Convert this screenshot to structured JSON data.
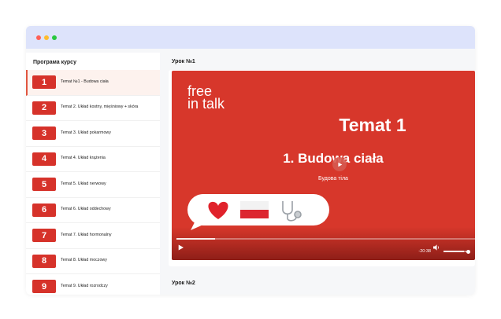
{
  "window": {
    "dots": [
      "#ff5f57",
      "#febc2e",
      "#28c840"
    ]
  },
  "sidebar": {
    "title": "Програма курсу",
    "items": [
      {
        "num": "1",
        "label": "Temat №1 - Budowa ciała"
      },
      {
        "num": "2",
        "label": "Temat 2. Układ kostny, mięśniowy + skóra"
      },
      {
        "num": "3",
        "label": "Temat 3. Układ pokarmowy"
      },
      {
        "num": "4",
        "label": "Temat 4. Układ krążenia"
      },
      {
        "num": "5",
        "label": "Temat 5. Układ nerwowy"
      },
      {
        "num": "6",
        "label": "Temat 6. Układ oddechowy"
      },
      {
        "num": "7",
        "label": "Temat 7. Układ hormonalny"
      },
      {
        "num": "8",
        "label": "Temat 8. Układ moczowy"
      },
      {
        "num": "9",
        "label": "Temat 9. Układ rozrodczy"
      }
    ]
  },
  "main": {
    "lesson1_title": "Урок №1",
    "lesson2_title": "Урок №2",
    "video": {
      "logo_line1": "free",
      "logo_line2": "in talk",
      "topic_title": "Temat 1",
      "topic_subtitle": "1. Budowa ciała",
      "topic_ukrainian": "Будова тіла",
      "emojis": [
        "heart-emoji",
        "poland-flag-emoji",
        "stethoscope-emoji"
      ],
      "time_remaining": "-20:38",
      "progress_fraction": 0.13,
      "volume_fraction": 0.8
    }
  },
  "colors": {
    "accent_red": "#d6322a",
    "video_bg": "#d7372b",
    "titlebar": "#dde3fb"
  }
}
